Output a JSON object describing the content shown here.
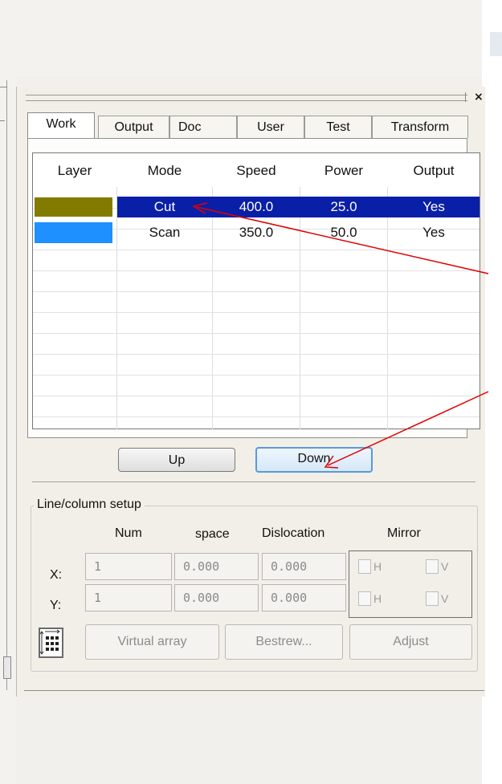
{
  "tabs": [
    {
      "label": "Work"
    },
    {
      "label": "Output"
    },
    {
      "label": "Doc"
    },
    {
      "label": "User"
    },
    {
      "label": "Test"
    },
    {
      "label": "Transform"
    }
  ],
  "close_label": "×",
  "layer_table": {
    "headers": [
      "Layer",
      "Mode",
      "Speed",
      "Power",
      "Output"
    ],
    "rows": [
      {
        "color": "#827b00",
        "mode": "Cut",
        "speed": "400.0",
        "power": "25.0",
        "output": "Yes",
        "selected": true
      },
      {
        "color": "#1e90ff",
        "mode": "Scan",
        "speed": "350.0",
        "power": "50.0",
        "output": "Yes",
        "selected": false
      }
    ]
  },
  "buttons": {
    "up": "Up",
    "down": "Down"
  },
  "line_column": {
    "title": "Line/column setup",
    "col_num": "Num",
    "col_space": "space",
    "col_dislocation": "Dislocation",
    "col_mirror": "Mirror",
    "x_label": "X:",
    "y_label": "Y:",
    "x_num": "1",
    "x_space": "0.000",
    "x_dislocation": "0.000",
    "y_num": "1",
    "y_space": "0.000",
    "y_dislocation": "0.000",
    "mirror_h": "H",
    "mirror_v": "V",
    "virtual_array": "Virtual array",
    "bestrew": "Bestrew...",
    "adjust": "Adjust"
  },
  "colors": {
    "selection": "#0a1fa8",
    "annotation": "#e00000",
    "focus_border": "#5a9ad8"
  }
}
